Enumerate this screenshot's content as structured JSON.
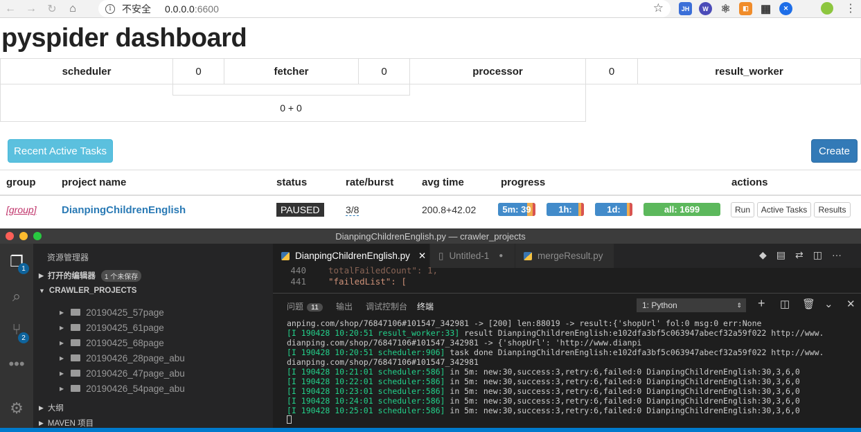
{
  "browser": {
    "insecure_label": "不安全",
    "host": "0.0.0.0",
    "port": ":6600"
  },
  "dashboard": {
    "title": "pyspider dashboard",
    "stats": {
      "scheduler_label": "scheduler",
      "scheduler_value": "0",
      "fetcher_label": "fetcher",
      "fetcher_value": "0",
      "processor_label": "processor",
      "processor_value": "0",
      "result_worker_label": "result_worker",
      "fetcher_sum": "0 + 0"
    },
    "recent_tasks_label": "Recent Active Tasks",
    "create_label": "Create",
    "columns": [
      "group",
      "project name",
      "status",
      "rate/burst",
      "avg time",
      "progress",
      "actions"
    ],
    "project": {
      "group": "[group]",
      "name": "DianpingChildrenEnglish",
      "status": "PAUSED",
      "rate": "3/8",
      "avg_time": "200.8+42.02",
      "progress": [
        {
          "label": "5m: 39",
          "success": 0.77,
          "retry": 0.15,
          "failed": 0.08
        },
        {
          "label": "1h:",
          "success": 0.85,
          "retry": 0.08,
          "failed": 0.07
        },
        {
          "label": "1d:",
          "success": 0.85,
          "retry": 0.08,
          "failed": 0.07
        },
        {
          "label": "all: 1699",
          "success": 0.0,
          "retry": 0.0,
          "failed": 0.0
        }
      ],
      "actions": [
        "Run",
        "Active Tasks",
        "Results"
      ]
    }
  },
  "vscode": {
    "title": "DianpingChildrenEnglish.py — crawler_projects",
    "explorer_title": "资源管理器",
    "open_editors": "打开的编辑器",
    "unsaved": "1 个未保存",
    "project_folder": "CRAWLER_PROJECTS",
    "folders": [
      "20190425_57page",
      "20190425_61page",
      "20190425_68page",
      "20190426_28page_abu",
      "20190426_47page_abu",
      "20190426_54page_abu"
    ],
    "outline": "大纲",
    "maven": "MAVEN 项目",
    "explorer_badge": "1",
    "scm_badge": "2",
    "tabs": [
      "DianpingChildrenEnglish.py",
      "Untitled-1",
      "mergeResult.py"
    ],
    "code_lines": [
      {
        "n": "440",
        "t": "totalFailedCount\": 1,"
      },
      {
        "n": "441",
        "t": "\"failedList\": ["
      }
    ],
    "panel_tabs": [
      "问题",
      "输出",
      "调试控制台",
      "终端"
    ],
    "problems_count": "11",
    "terminal_select": "1: Python",
    "terminal": [
      {
        "p": "",
        "t": "anping.com/shop/76847106#101547_342981 -> [200] len:88019 -> result:{'shopUrl' fol:0 msg:0 err:None"
      },
      {
        "p": "[I 190428 10:20:51 result_worker:33]",
        "t": " result DianpingChildrenEnglish:e102dfa3bf5c063947abecf32a59f022 http://www."
      },
      {
        "p": "",
        "t": "dianping.com/shop/76847106#101547_342981 -> {'shopUrl': 'http://www.dianpi"
      },
      {
        "p": "[I 190428 10:20:51 scheduler:906]",
        "t": " task done DianpingChildrenEnglish:e102dfa3bf5c063947abecf32a59f022 http://www."
      },
      {
        "p": "",
        "t": "dianping.com/shop/76847106#101547_342981"
      },
      {
        "p": "[I 190428 10:21:01 scheduler:586]",
        "t": " in 5m: new:30,success:3,retry:6,failed:0 DianpingChildrenEnglish:30,3,6,0"
      },
      {
        "p": "[I 190428 10:22:01 scheduler:586]",
        "t": " in 5m: new:30,success:3,retry:6,failed:0 DianpingChildrenEnglish:30,3,6,0"
      },
      {
        "p": "[I 190428 10:23:01 scheduler:586]",
        "t": " in 5m: new:30,success:3,retry:6,failed:0 DianpingChildrenEnglish:30,3,6,0"
      },
      {
        "p": "[I 190428 10:24:01 scheduler:586]",
        "t": " in 5m: new:30,success:3,retry:6,failed:0 DianpingChildrenEnglish:30,3,6,0"
      },
      {
        "p": "[I 190428 10:25:01 scheduler:586]",
        "t": " in 5m: new:30,success:3,retry:6,failed:0 DianpingChildrenEnglish:30,3,6,0"
      }
    ]
  },
  "colors": {
    "info_btn": "#5bc0de",
    "primary_btn": "#337ab7",
    "success": "#5cb85c",
    "retry": "#f0ad4e",
    "failed": "#d9534f",
    "progress_base": "#428bca"
  }
}
